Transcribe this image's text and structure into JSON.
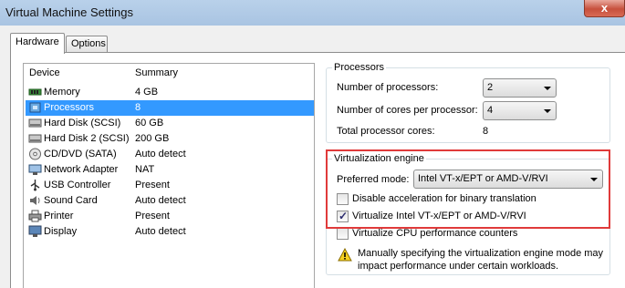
{
  "window": {
    "title": "Virtual Machine Settings",
    "close_label": "x"
  },
  "tabs": [
    {
      "label": "Hardware",
      "active": true
    },
    {
      "label": "Options",
      "active": false
    }
  ],
  "device_list": {
    "headers": {
      "device": "Device",
      "summary": "Summary"
    },
    "rows": [
      {
        "device": "Memory",
        "summary": "4 GB",
        "icon": "memory-icon",
        "selected": false
      },
      {
        "device": "Processors",
        "summary": "8",
        "icon": "processor-icon",
        "selected": true
      },
      {
        "device": "Hard Disk (SCSI)",
        "summary": "60 GB",
        "icon": "hard-disk-icon",
        "selected": false
      },
      {
        "device": "Hard Disk 2 (SCSI)",
        "summary": "200 GB",
        "icon": "hard-disk-icon",
        "selected": false
      },
      {
        "device": "CD/DVD (SATA)",
        "summary": "Auto detect",
        "icon": "cd-dvd-icon",
        "selected": false
      },
      {
        "device": "Network Adapter",
        "summary": "NAT",
        "icon": "network-adapter-icon",
        "selected": false
      },
      {
        "device": "USB Controller",
        "summary": "Present",
        "icon": "usb-icon",
        "selected": false
      },
      {
        "device": "Sound Card",
        "summary": "Auto detect",
        "icon": "speaker-icon",
        "selected": false
      },
      {
        "device": "Printer",
        "summary": "Present",
        "icon": "printer-icon",
        "selected": false
      },
      {
        "device": "Display",
        "summary": "Auto detect",
        "icon": "display-icon",
        "selected": false
      }
    ]
  },
  "processors": {
    "legend": "Processors",
    "num_processors_label": "Number of processors:",
    "num_processors_value": "2",
    "cores_label": "Number of cores per processor:",
    "cores_value": "4",
    "total_label": "Total processor cores:",
    "total_value": "8"
  },
  "virtualization": {
    "legend": "Virtualization engine",
    "preferred_mode_label": "Preferred mode:",
    "preferred_mode_value": "Intel VT-x/EPT or AMD-V/RVI",
    "disable_accel_label": "Disable acceleration for binary translation",
    "disable_accel_checked": false,
    "virtualize_label": "Virtualize Intel VT-x/EPT or AMD-V/RVI",
    "virtualize_checked": true,
    "perf_counters_label": "Virtualize CPU performance counters",
    "perf_counters_checked": false,
    "warning_text_line1": "Manually specifying the virtualization engine mode may",
    "warning_text_line2": "impact performance under certain workloads."
  },
  "colors": {
    "selection": "#3399ff",
    "highlight_box": "#e03a3a"
  }
}
